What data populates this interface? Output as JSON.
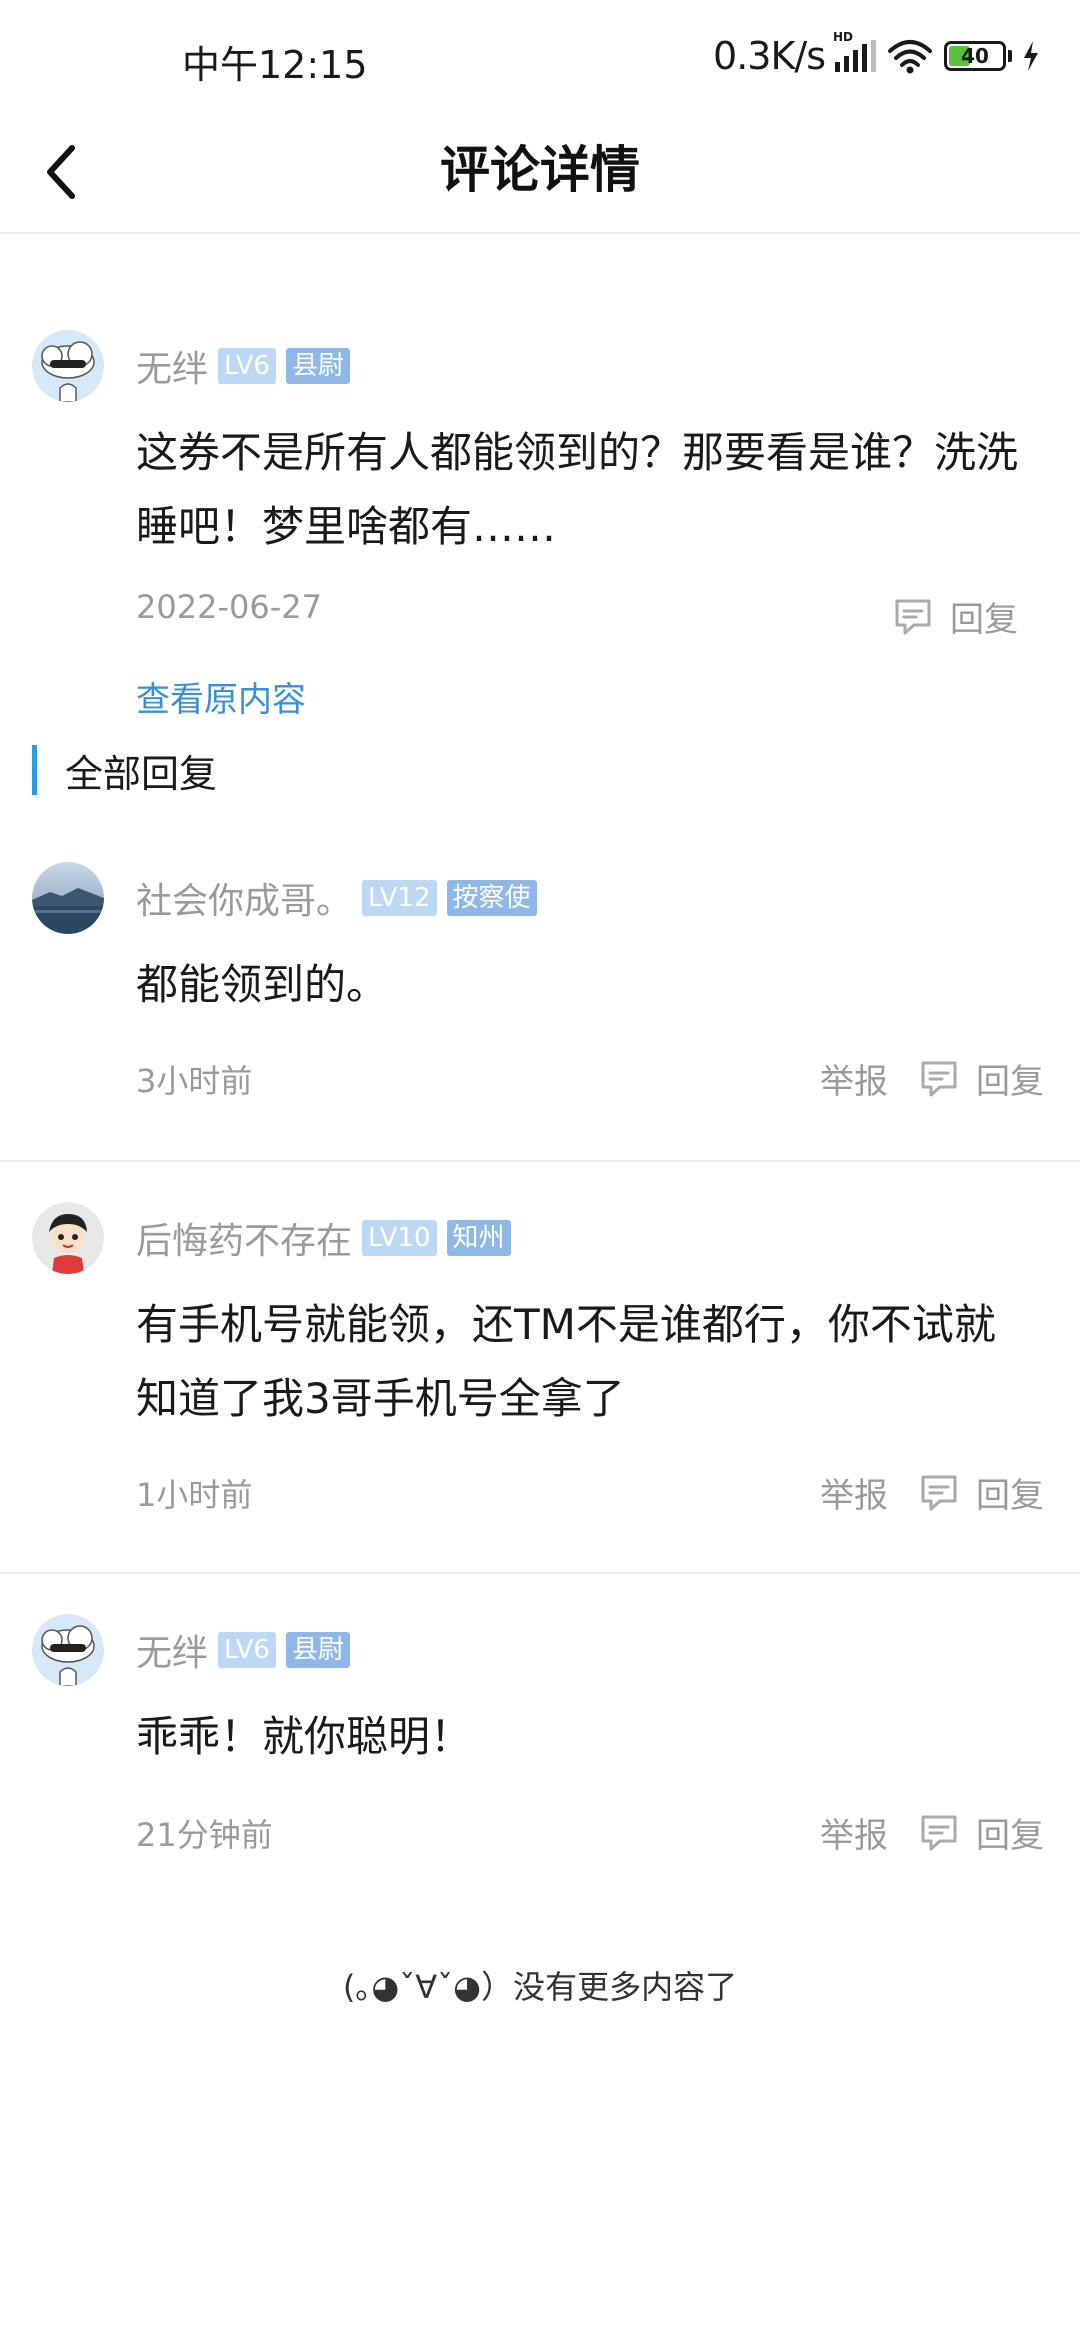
{
  "status": {
    "time": "中午12:15",
    "net_speed": "0.3K/s",
    "signal_hd": "HD",
    "battery": "40",
    "battery_level": 0.4
  },
  "header": {
    "title": "评论详情"
  },
  "main_comment": {
    "user": "无绊",
    "level": "LV6",
    "rank": "县尉",
    "text": "这券不是所有人都能领到的？那要看是谁？洗洗睡吧！梦里啥都有……",
    "date": "2022-06-27",
    "reply_label": "回复",
    "view_original": "查看原内容",
    "avatar_icon": "cloud-sunglasses-avatar"
  },
  "replies_section": {
    "title": "全部回复"
  },
  "replies": [
    {
      "user": "社会你成哥。",
      "level": "LV12",
      "rank": "按察使",
      "text": "都能领到的。",
      "time": "3小时前",
      "report_label": "举报",
      "reply_label": "回复",
      "avatar_icon": "landscape-avatar"
    },
    {
      "user": "后悔药不存在",
      "level": "LV10",
      "rank": "知州",
      "text": "有手机号就能领，还TM不是谁都行，你不试就知道了我3哥手机号全拿了",
      "time": "1小时前",
      "report_label": "举报",
      "reply_label": "回复",
      "avatar_icon": "cartoon-boy-avatar"
    },
    {
      "user": "无绊",
      "level": "LV6",
      "rank": "县尉",
      "text": "乖乖！就你聪明！",
      "time": "21分钟前",
      "report_label": "举报",
      "reply_label": "回复",
      "avatar_icon": "cloud-sunglasses-avatar"
    }
  ],
  "footer": {
    "end_text": "(｡◕ˇ∀ˇ◕）没有更多内容了"
  },
  "colors": {
    "accent": "#2a9ae8",
    "link": "#3a8fd9",
    "level_badge": "#bcd8f5",
    "rank_badge": "#8fb8e8",
    "muted_text": "#9a9a9a"
  }
}
